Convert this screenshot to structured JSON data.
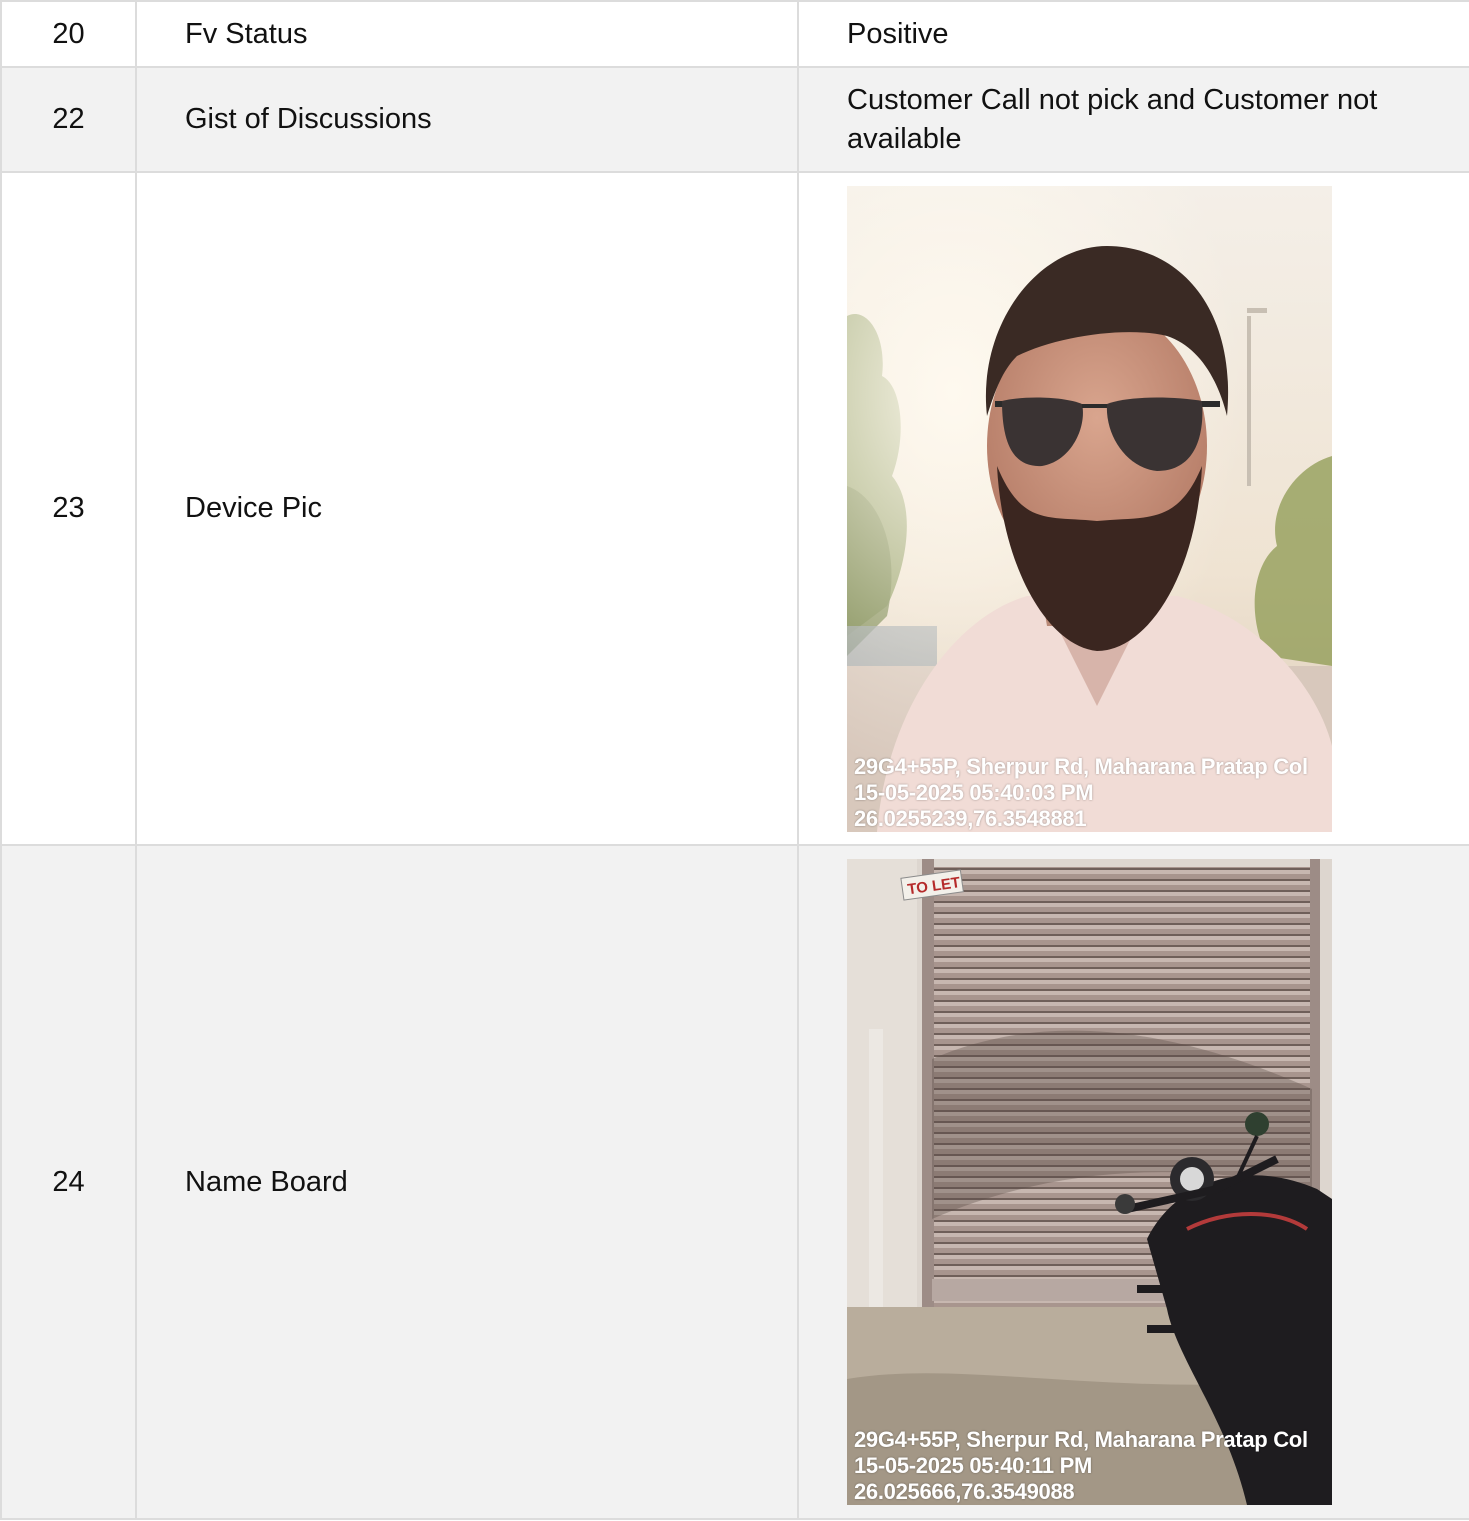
{
  "rows": [
    {
      "num": "20",
      "label": "Fv Status",
      "value": "Positive"
    },
    {
      "num": "22",
      "label": "Gist of Discussions",
      "value": "Customer Call not pick and Customer not available"
    },
    {
      "num": "23",
      "label": "Device Pic",
      "photo": {
        "subject": "selfie of bearded man in sunglasses and white shirt outdoors",
        "stamp_address": "29G4+55P, Sherpur Rd, Maharana Pratap Col",
        "stamp_datetime": "15-05-2025 05:40:03 PM",
        "stamp_coords": "26.0255239,76.3548881"
      }
    },
    {
      "num": "24",
      "label": "Name Board",
      "photo": {
        "subject": "closed rolling shutter with TO LET sign and parked motorcycle",
        "sign_text": "TO LET",
        "stamp_address": "29G4+55P, Sherpur Rd, Maharana Pratap Col",
        "stamp_datetime": "15-05-2025 05:40:11 PM",
        "stamp_coords": "26.025666,76.3549088"
      }
    }
  ],
  "colors": {
    "border": "#dcdcdc",
    "shade": "#f2f2f2",
    "stamp_text": "#ffffff"
  }
}
